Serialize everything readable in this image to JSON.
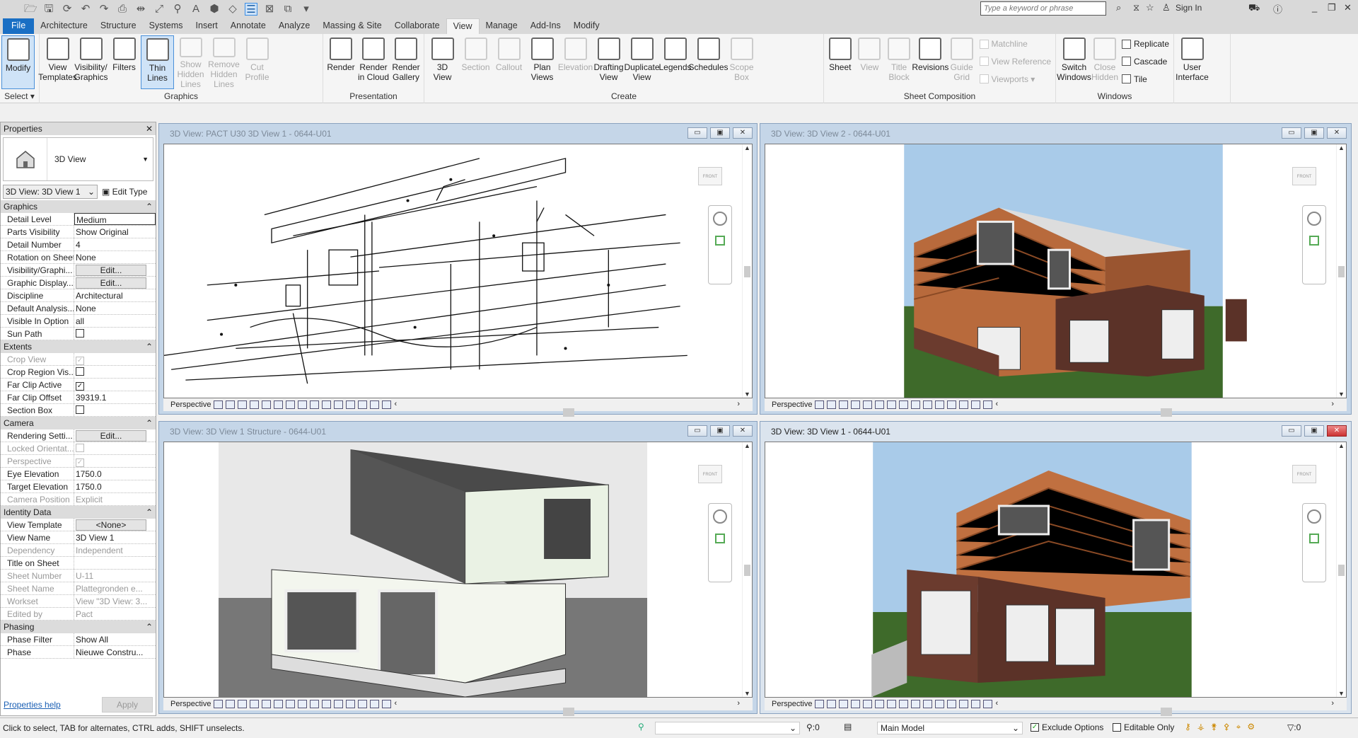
{
  "qat": {
    "icons": [
      "open-icon",
      "save-icon",
      "sync-icon",
      "undo-icon",
      "redo-icon",
      "print-icon",
      "measure-icon",
      "dimension-icon",
      "tag-icon",
      "text-icon",
      "3d-view-icon",
      "section-icon",
      "thin-lines-icon",
      "close-hidden-icon",
      "switch-windows-icon",
      "customize-icon"
    ]
  },
  "title_bar": {
    "search_placeholder": "Type a keyword or phrase",
    "sign_in": "Sign In"
  },
  "tabs": [
    "File",
    "Architecture",
    "Structure",
    "Systems",
    "Insert",
    "Annotate",
    "Analyze",
    "Massing & Site",
    "Collaborate",
    "View",
    "Manage",
    "Add-Ins",
    "Modify"
  ],
  "active_tab": "View",
  "ribbon": {
    "panels": [
      {
        "label": "Select ▾",
        "w": 56,
        "buttons": [
          {
            "label": "Modify",
            "on": true
          }
        ]
      },
      {
        "label": "Graphics",
        "w": 401,
        "buttons": [
          {
            "label": "View\nTemplates"
          },
          {
            "label": "Visibility/\nGraphics"
          },
          {
            "label": "Filters"
          },
          {
            "label": "Thin\nLines",
            "on": true
          },
          {
            "label": "Show\nHidden Lines",
            "dis": true
          },
          {
            "label": "Remove\nHidden Lines",
            "dis": true
          },
          {
            "label": "Cut\nProfile",
            "dis": true
          }
        ]
      },
      {
        "label": "Presentation",
        "w": 143,
        "buttons": [
          {
            "label": "Render"
          },
          {
            "label": "Render\nin Cloud"
          },
          {
            "label": "Render\nGallery"
          }
        ]
      },
      {
        "label": "Create",
        "w": 565,
        "buttons": [
          {
            "label": "3D\nView"
          },
          {
            "label": "Section",
            "dis": true
          },
          {
            "label": "Callout",
            "dis": true
          },
          {
            "label": "Plan\nViews"
          },
          {
            "label": "Elevation",
            "dis": true
          },
          {
            "label": "Drafting\nView"
          },
          {
            "label": "Duplicate\nView"
          },
          {
            "label": "Legends"
          },
          {
            "label": "Schedules"
          },
          {
            "label": "Scope\nBox",
            "dis": true
          }
        ]
      },
      {
        "label": "Sheet Composition",
        "w": 328,
        "buttons": [
          {
            "label": "Sheet"
          },
          {
            "label": "View",
            "dis": true
          },
          {
            "label": "Title\nBlock",
            "dis": true
          },
          {
            "label": "Revisions"
          },
          {
            "label": "Guide\nGrid",
            "dis": true
          }
        ],
        "small": [
          {
            "label": "Matchline",
            "dis": true
          },
          {
            "label": "View  Reference",
            "dis": true
          },
          {
            "label": "Viewports ▾",
            "dis": true
          }
        ]
      },
      {
        "label": "Windows",
        "w": 167,
        "buttons": [
          {
            "label": "Switch\nWindows"
          },
          {
            "label": "Close\nHidden",
            "dis": true
          }
        ],
        "small": [
          {
            "label": "Replicate"
          },
          {
            "label": "Cascade"
          },
          {
            "label": "Tile"
          }
        ]
      },
      {
        "label": "",
        "w": 80,
        "buttons": [
          {
            "label": "User\nInterface"
          }
        ]
      }
    ]
  },
  "properties": {
    "title": "Properties",
    "type_name": "3D View",
    "instance": "3D View: 3D View 1",
    "edit_type": "Edit Type",
    "sections": [
      {
        "name": "Graphics",
        "rows": [
          {
            "label": "Detail Level",
            "value": "Medium"
          },
          {
            "label": "Parts Visibility",
            "value": "Show Original"
          },
          {
            "label": "Detail Number",
            "value": "4"
          },
          {
            "label": "Rotation on Sheet",
            "value": "None"
          },
          {
            "label": "Visibility/Graphi...",
            "value": "Edit...",
            "button": true
          },
          {
            "label": "Graphic Display...",
            "value": "Edit...",
            "button": true
          },
          {
            "label": "Discipline",
            "value": "Architectural"
          },
          {
            "label": "Default Analysis...",
            "value": "None"
          },
          {
            "label": "Visible In Option",
            "value": "all"
          },
          {
            "label": "Sun Path",
            "check": false
          }
        ]
      },
      {
        "name": "Extents",
        "rows": [
          {
            "label": "Crop View",
            "check": true,
            "dis": true
          },
          {
            "label": "Crop Region Vis...",
            "check": false
          },
          {
            "label": "Far Clip Active",
            "check": true
          },
          {
            "label": "Far Clip Offset",
            "value": "39319.1"
          },
          {
            "label": "Section Box",
            "check": false
          }
        ]
      },
      {
        "name": "Camera",
        "rows": [
          {
            "label": "Rendering Setti...",
            "value": "Edit...",
            "button": true
          },
          {
            "label": "Locked Orientat...",
            "check": false,
            "dis": true
          },
          {
            "label": "Perspective",
            "check": true,
            "dis": true
          },
          {
            "label": "Eye Elevation",
            "value": "1750.0"
          },
          {
            "label": "Target Elevation",
            "value": "1750.0"
          },
          {
            "label": "Camera Position",
            "value": "Explicit",
            "dis": true
          }
        ]
      },
      {
        "name": "Identity Data",
        "rows": [
          {
            "label": "View Template",
            "value": "<None>",
            "button": true
          },
          {
            "label": "View Name",
            "value": "3D View 1"
          },
          {
            "label": "Dependency",
            "value": "Independent",
            "dis": true
          },
          {
            "label": "Title on Sheet",
            "value": ""
          },
          {
            "label": "Sheet Number",
            "value": "U-11",
            "dis": true
          },
          {
            "label": "Sheet Name",
            "value": "Plattegronden e...",
            "dis": true
          },
          {
            "label": "Workset",
            "value": "View \"3D View: 3...",
            "dis": true
          },
          {
            "label": "Edited by",
            "value": "Pact",
            "dis": true
          }
        ]
      },
      {
        "name": "Phasing",
        "rows": [
          {
            "label": "Phase Filter",
            "value": "Show All"
          },
          {
            "label": "Phase",
            "value": "Nieuwe Constru..."
          }
        ]
      }
    ],
    "help": "Properties help",
    "apply": "Apply"
  },
  "views": [
    {
      "title": "3D View: PACT U30 3D View 1 - 0644-U01",
      "mode": "Perspective",
      "active": false,
      "scene": "wire"
    },
    {
      "title": "3D View: 3D View 2 - 0644-U01",
      "mode": "Perspective",
      "active": false,
      "scene": "houseA"
    },
    {
      "title": "3D View: 3D View 1 Structure - 0644-U01",
      "mode": "Perspective",
      "active": false,
      "scene": "struct"
    },
    {
      "title": "3D View: 3D View 1 - 0644-U01",
      "mode": "Perspective",
      "active": true,
      "scene": "houseB"
    }
  ],
  "view_cube_label": "FRONT",
  "status": {
    "hint": "Click to select, TAB for alternates, CTRL adds, SHIFT unselects.",
    "workset_count": ":0",
    "design_option": "Main Model",
    "exclude_options": "Exclude Options",
    "exclude_checked": true,
    "editable_only": "Editable Only",
    "editable_checked": false,
    "filter_count": ":0"
  },
  "colors": {
    "file_tab": "#1a6fc4",
    "view_active_bg": "#dbe4ee",
    "facade": "#b86a3c",
    "brick": "#6b3b2e",
    "grass": "#3e6a2a",
    "sky": "#9cc3e6"
  }
}
